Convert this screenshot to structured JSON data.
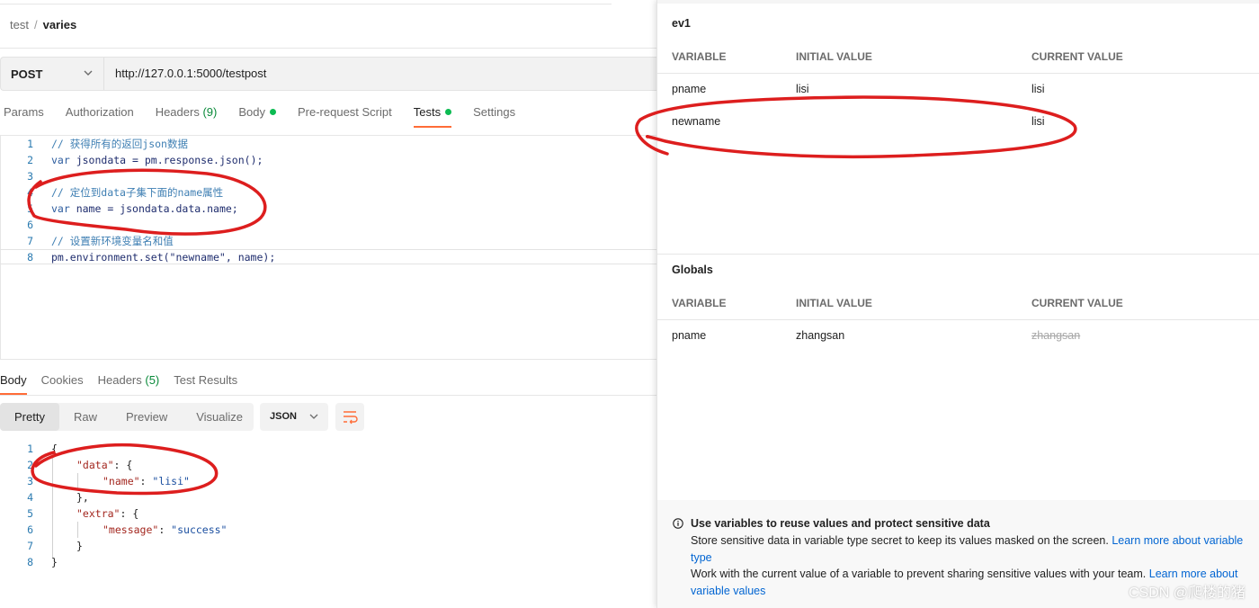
{
  "breadcrumb": {
    "parent": "test",
    "separator": "/",
    "current": "varies"
  },
  "request": {
    "method": "POST",
    "url": "http://127.0.0.1:5000/testpost",
    "tabs": {
      "params": "Params",
      "authorization": "Authorization",
      "headers": "Headers",
      "headers_count": "(9)",
      "body": "Body",
      "prerequest": "Pre-request Script",
      "tests": "Tests",
      "settings": "Settings"
    }
  },
  "tests_script": {
    "lines": [
      {
        "n": "1",
        "comment": "// 获得所有的返回json数据"
      },
      {
        "n": "2",
        "kw": "var",
        "rest": " jsondata = pm.response.json();"
      },
      {
        "n": "3"
      },
      {
        "n": "4",
        "comment": "// 定位到data子集下面的name属性"
      },
      {
        "n": "5",
        "kw": "var",
        "rest": " name = jsondata.data.name;"
      },
      {
        "n": "6"
      },
      {
        "n": "7",
        "comment": "// 设置新环境变量名和值"
      },
      {
        "n": "8",
        "rest": "pm.environment.set(\"newname\", name);"
      }
    ]
  },
  "response": {
    "tabs": {
      "body": "Body",
      "cookies": "Cookies",
      "headers": "Headers",
      "headers_count": "(5)",
      "test_results": "Test Results"
    },
    "view_modes": [
      "Pretty",
      "Raw",
      "Preview",
      "Visualize"
    ],
    "format": "JSON",
    "json_lines": [
      {
        "n": "1",
        "text": "{"
      },
      {
        "n": "2",
        "key": "\"data\"",
        "after": ": {"
      },
      {
        "n": "3",
        "key": "\"name\"",
        "sep": ": ",
        "val": "\"lisi\""
      },
      {
        "n": "4",
        "text": "},"
      },
      {
        "n": "5",
        "key": "\"extra\"",
        "after": ": {"
      },
      {
        "n": "6",
        "key": "\"message\"",
        "sep": ": ",
        "val": "\"success\""
      },
      {
        "n": "7",
        "text": "}"
      },
      {
        "n": "8",
        "text": "}"
      }
    ]
  },
  "environment": {
    "name": "ev1",
    "headers": {
      "variable": "VARIABLE",
      "initial": "INITIAL VALUE",
      "current": "CURRENT VALUE"
    },
    "rows": [
      {
        "variable": "pname",
        "initial": "lisi",
        "current": "lisi"
      },
      {
        "variable": "newname",
        "initial": "",
        "current": "lisi"
      }
    ]
  },
  "globals": {
    "name": "Globals",
    "headers": {
      "variable": "VARIABLE",
      "initial": "INITIAL VALUE",
      "current": "CURRENT VALUE"
    },
    "rows": [
      {
        "variable": "pname",
        "initial": "zhangsan",
        "current": "zhangsan"
      }
    ]
  },
  "info": {
    "title": "Use variables to reuse values and protect sensitive data",
    "line1": "Store sensitive data in variable type secret to keep its values masked on the screen.",
    "link1a": "Learn more about variable",
    "link1b": "type",
    "line2": "Work with the current value of a variable to prevent sharing sensitive values with your team.",
    "link2a": "Learn more about",
    "link2b": "variable values"
  },
  "watermark": "CSDN @爬楼的猪",
  "colors": {
    "accent": "#ff6c37",
    "green": "#0cbb52",
    "annotation": "#dd1e1e",
    "link": "#0265d2"
  }
}
